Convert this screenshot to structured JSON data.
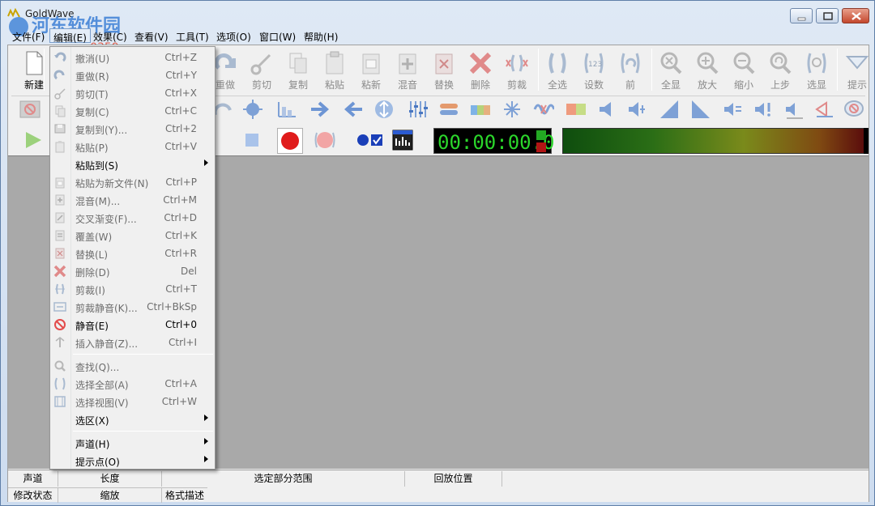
{
  "window": {
    "title": "GoldWave"
  },
  "watermark": {
    "line1": "河东软件园",
    "line2": "www.pc0359.cn"
  },
  "menubar": [
    {
      "label": "文件(F)"
    },
    {
      "label": "编辑(E)"
    },
    {
      "label": "效果(C)"
    },
    {
      "label": "查看(V)"
    },
    {
      "label": "工具(T)"
    },
    {
      "label": "选项(O)"
    },
    {
      "label": "窗口(W)"
    },
    {
      "label": "帮助(H)"
    }
  ],
  "toolbar": {
    "new_label": "新建",
    "buttons": [
      {
        "label": "重做",
        "icon": "redo-icon"
      },
      {
        "label": "剪切",
        "icon": "cut-icon"
      },
      {
        "label": "复制",
        "icon": "copy-icon"
      },
      {
        "label": "粘贴",
        "icon": "paste-icon"
      },
      {
        "label": "粘新",
        "icon": "paste-new-icon"
      },
      {
        "label": "混音",
        "icon": "mix-icon"
      },
      {
        "label": "替换",
        "icon": "replace-icon"
      },
      {
        "label": "删除",
        "icon": "delete-icon"
      },
      {
        "label": "剪裁",
        "icon": "trim-icon"
      },
      {
        "label": "全选",
        "icon": "select-all-icon"
      },
      {
        "label": "设数",
        "icon": "set-value-icon"
      },
      {
        "label": "前",
        "icon": "previous-icon"
      },
      {
        "label": "全显",
        "icon": "zoom-all-icon"
      },
      {
        "label": "放大",
        "icon": "zoom-in-icon"
      },
      {
        "label": "缩小",
        "icon": "zoom-out-icon"
      },
      {
        "label": "上步",
        "icon": "zoom-previous-icon"
      },
      {
        "label": "选显",
        "icon": "zoom-selection-icon"
      },
      {
        "label": "提示",
        "icon": "cue-icon"
      }
    ]
  },
  "transport": {
    "time": "00:00:00.0"
  },
  "edit_menu": {
    "items": [
      {
        "label": "撤消(U)",
        "shortcut": "Ctrl+Z",
        "icon": "undo-icon"
      },
      {
        "label": "重做(R)",
        "shortcut": "Ctrl+Y",
        "icon": "redo-icon"
      },
      {
        "label": "剪切(T)",
        "shortcut": "Ctrl+X",
        "icon": "cut-icon"
      },
      {
        "label": "复制(C)",
        "shortcut": "Ctrl+C",
        "icon": "copy-icon"
      },
      {
        "label": "复制到(Y)...",
        "shortcut": "Ctrl+2",
        "icon": "copy-to-icon"
      },
      {
        "label": "粘贴(P)",
        "shortcut": "Ctrl+V",
        "icon": "paste-icon"
      },
      {
        "label": "粘贴到(S)",
        "shortcut": "",
        "icon": ""
      },
      {
        "label": "粘贴为新文件(N)",
        "shortcut": "Ctrl+P",
        "icon": "paste-new-icon"
      },
      {
        "label": "混音(M)...",
        "shortcut": "Ctrl+M",
        "icon": "mix-icon"
      },
      {
        "label": "交叉渐变(F)...",
        "shortcut": "Ctrl+D",
        "icon": "crossfade-icon"
      },
      {
        "label": "覆盖(W)",
        "shortcut": "Ctrl+K",
        "icon": "overwrite-icon"
      },
      {
        "label": "替换(L)",
        "shortcut": "Ctrl+R",
        "icon": "replace-icon"
      },
      {
        "label": "删除(D)",
        "shortcut": "Del",
        "icon": "delete-icon"
      },
      {
        "label": "剪裁(I)",
        "shortcut": "Ctrl+T",
        "icon": "trim-icon"
      },
      {
        "label": "剪裁静音(K)...",
        "shortcut": "Ctrl+BkSp",
        "icon": "trim-silence-icon"
      },
      {
        "label": "静音(E)",
        "shortcut": "Ctrl+0",
        "icon": "silence-icon"
      },
      {
        "label": "插入静音(Z)...",
        "shortcut": "Ctrl+I",
        "icon": "insert-silence-icon"
      },
      {
        "label": "查找(Q)...",
        "shortcut": "",
        "icon": "find-icon"
      },
      {
        "label": "选择全部(A)",
        "shortcut": "Ctrl+A",
        "icon": "select-all-icon"
      },
      {
        "label": "选择视图(V)",
        "shortcut": "Ctrl+W",
        "icon": "select-view-icon"
      },
      {
        "label": "选区(X)",
        "shortcut": "",
        "icon": ""
      },
      {
        "label": "声道(H)",
        "shortcut": "",
        "icon": ""
      },
      {
        "label": "提示点(O)",
        "shortcut": "",
        "icon": ""
      }
    ]
  },
  "statusbar": {
    "row1": [
      "声道",
      "长度",
      "选定部分范围",
      "回放位置"
    ],
    "row2": [
      "修改状态",
      "缩放",
      "格式描述"
    ]
  }
}
